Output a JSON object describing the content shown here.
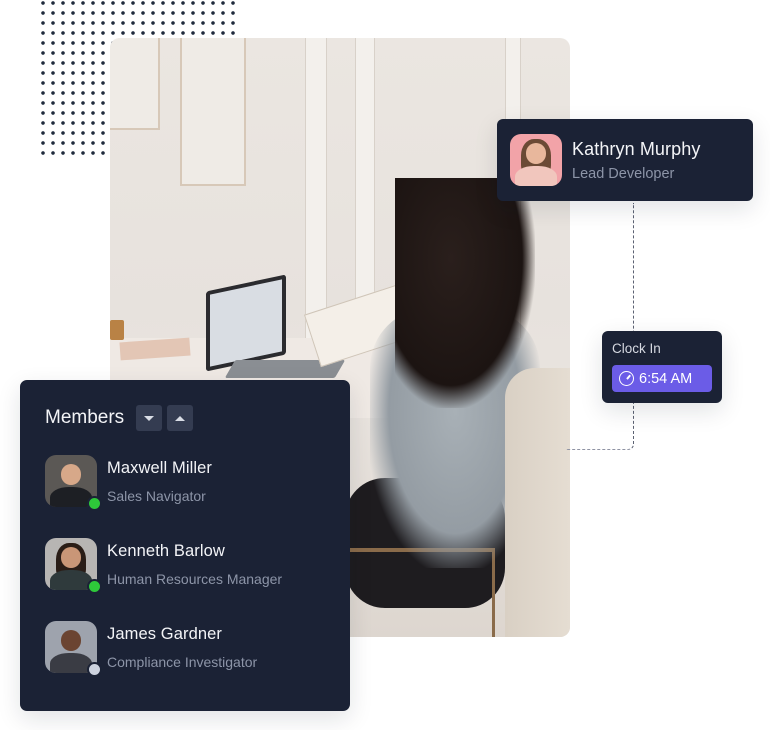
{
  "hero_photo": {
    "description": "Woman with long dark hair in grey hoodie working on a laptop at a white table"
  },
  "profile_card": {
    "name": "Kathryn Murphy",
    "role": "Lead Developer",
    "avatar_bg": "#f2a3a8"
  },
  "clock_card": {
    "title": "Clock In",
    "time": "6:54 AM",
    "icon": "clock-icon",
    "accent": "#6b5ce7"
  },
  "members_panel": {
    "title": "Members",
    "sort_down_icon": "caret-down-icon",
    "sort_up_icon": "caret-up-icon",
    "members": [
      {
        "name": "Maxwell Miller",
        "role": "Sales Navigator",
        "status": "online",
        "status_color": "#2ec83a"
      },
      {
        "name": "Kenneth Barlow",
        "role": "Human Resources Manager",
        "status": "online",
        "status_color": "#2ec83a"
      },
      {
        "name": "James Gardner",
        "role": "Compliance Investigator",
        "status": "offline",
        "status_color": "#cdd3df"
      }
    ]
  },
  "colors": {
    "card_bg": "#1b2235",
    "muted_text": "#8d95a8",
    "button_bg": "#343c51"
  }
}
